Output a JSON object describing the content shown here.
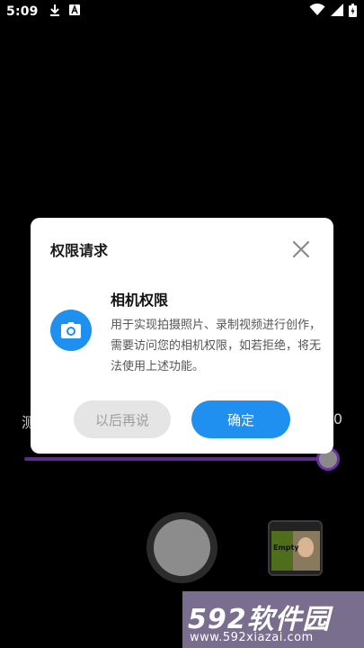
{
  "status_bar": {
    "time": "5:09",
    "icons": [
      "download-icon",
      "a-badge-icon",
      "wifi-icon",
      "signal-icon",
      "battery-icon"
    ]
  },
  "background": {
    "slider_left_label": "测",
    "slider_right_label": "0",
    "slider_value": 1.0,
    "thumbnail_text": "Empty"
  },
  "dialog": {
    "title": "权限请求",
    "permission_heading": "相机权限",
    "permission_description": "用于实现拍摄照片、录制视频进行创作，需要访问您的相机权限，如若拒绝，将无法使用上述功能。",
    "cancel_label": "以后再说",
    "confirm_label": "确定",
    "icon": "camera-icon",
    "accent_color": "#1f8ff0"
  },
  "watermark": {
    "logo": "592软件园",
    "url": "www.592xiazai.com"
  }
}
